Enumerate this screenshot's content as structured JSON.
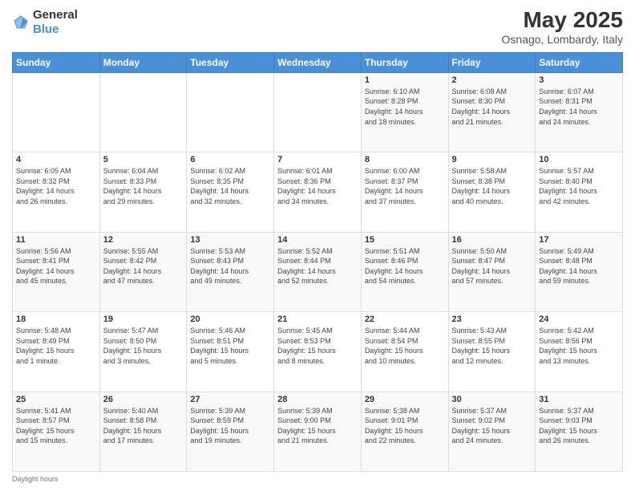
{
  "header": {
    "logo_general": "General",
    "logo_blue": "Blue",
    "month": "May 2025",
    "location": "Osnago, Lombardy, Italy"
  },
  "weekdays": [
    "Sunday",
    "Monday",
    "Tuesday",
    "Wednesday",
    "Thursday",
    "Friday",
    "Saturday"
  ],
  "weeks": [
    [
      {
        "day": "",
        "info": ""
      },
      {
        "day": "",
        "info": ""
      },
      {
        "day": "",
        "info": ""
      },
      {
        "day": "",
        "info": ""
      },
      {
        "day": "1",
        "info": "Sunrise: 6:10 AM\nSunset: 8:28 PM\nDaylight: 14 hours\nand 18 minutes."
      },
      {
        "day": "2",
        "info": "Sunrise: 6:08 AM\nSunset: 8:30 PM\nDaylight: 14 hours\nand 21 minutes."
      },
      {
        "day": "3",
        "info": "Sunrise: 6:07 AM\nSunset: 8:31 PM\nDaylight: 14 hours\nand 24 minutes."
      }
    ],
    [
      {
        "day": "4",
        "info": "Sunrise: 6:05 AM\nSunset: 8:32 PM\nDaylight: 14 hours\nand 26 minutes."
      },
      {
        "day": "5",
        "info": "Sunrise: 6:04 AM\nSunset: 8:33 PM\nDaylight: 14 hours\nand 29 minutes."
      },
      {
        "day": "6",
        "info": "Sunrise: 6:02 AM\nSunset: 8:35 PM\nDaylight: 14 hours\nand 32 minutes."
      },
      {
        "day": "7",
        "info": "Sunrise: 6:01 AM\nSunset: 8:36 PM\nDaylight: 14 hours\nand 34 minutes."
      },
      {
        "day": "8",
        "info": "Sunrise: 6:00 AM\nSunset: 8:37 PM\nDaylight: 14 hours\nand 37 minutes."
      },
      {
        "day": "9",
        "info": "Sunrise: 5:58 AM\nSunset: 8:38 PM\nDaylight: 14 hours\nand 40 minutes."
      },
      {
        "day": "10",
        "info": "Sunrise: 5:57 AM\nSunset: 8:40 PM\nDaylight: 14 hours\nand 42 minutes."
      }
    ],
    [
      {
        "day": "11",
        "info": "Sunrise: 5:56 AM\nSunset: 8:41 PM\nDaylight: 14 hours\nand 45 minutes."
      },
      {
        "day": "12",
        "info": "Sunrise: 5:55 AM\nSunset: 8:42 PM\nDaylight: 14 hours\nand 47 minutes."
      },
      {
        "day": "13",
        "info": "Sunrise: 5:53 AM\nSunset: 8:43 PM\nDaylight: 14 hours\nand 49 minutes."
      },
      {
        "day": "14",
        "info": "Sunrise: 5:52 AM\nSunset: 8:44 PM\nDaylight: 14 hours\nand 52 minutes."
      },
      {
        "day": "15",
        "info": "Sunrise: 5:51 AM\nSunset: 8:46 PM\nDaylight: 14 hours\nand 54 minutes."
      },
      {
        "day": "16",
        "info": "Sunrise: 5:50 AM\nSunset: 8:47 PM\nDaylight: 14 hours\nand 57 minutes."
      },
      {
        "day": "17",
        "info": "Sunrise: 5:49 AM\nSunset: 8:48 PM\nDaylight: 14 hours\nand 59 minutes."
      }
    ],
    [
      {
        "day": "18",
        "info": "Sunrise: 5:48 AM\nSunset: 8:49 PM\nDaylight: 15 hours\nand 1 minute."
      },
      {
        "day": "19",
        "info": "Sunrise: 5:47 AM\nSunset: 8:50 PM\nDaylight: 15 hours\nand 3 minutes."
      },
      {
        "day": "20",
        "info": "Sunrise: 5:46 AM\nSunset: 8:51 PM\nDaylight: 15 hours\nand 5 minutes."
      },
      {
        "day": "21",
        "info": "Sunrise: 5:45 AM\nSunset: 8:53 PM\nDaylight: 15 hours\nand 8 minutes."
      },
      {
        "day": "22",
        "info": "Sunrise: 5:44 AM\nSunset: 8:54 PM\nDaylight: 15 hours\nand 10 minutes."
      },
      {
        "day": "23",
        "info": "Sunrise: 5:43 AM\nSunset: 8:55 PM\nDaylight: 15 hours\nand 12 minutes."
      },
      {
        "day": "24",
        "info": "Sunrise: 5:42 AM\nSunset: 8:56 PM\nDaylight: 15 hours\nand 13 minutes."
      }
    ],
    [
      {
        "day": "25",
        "info": "Sunrise: 5:41 AM\nSunset: 8:57 PM\nDaylight: 15 hours\nand 15 minutes."
      },
      {
        "day": "26",
        "info": "Sunrise: 5:40 AM\nSunset: 8:58 PM\nDaylight: 15 hours\nand 17 minutes."
      },
      {
        "day": "27",
        "info": "Sunrise: 5:39 AM\nSunset: 8:59 PM\nDaylight: 15 hours\nand 19 minutes."
      },
      {
        "day": "28",
        "info": "Sunrise: 5:39 AM\nSunset: 9:00 PM\nDaylight: 15 hours\nand 21 minutes."
      },
      {
        "day": "29",
        "info": "Sunrise: 5:38 AM\nSunset: 9:01 PM\nDaylight: 15 hours\nand 22 minutes."
      },
      {
        "day": "30",
        "info": "Sunrise: 5:37 AM\nSunset: 9:02 PM\nDaylight: 15 hours\nand 24 minutes."
      },
      {
        "day": "31",
        "info": "Sunrise: 5:37 AM\nSunset: 9:03 PM\nDaylight: 15 hours\nand 26 minutes."
      }
    ]
  ],
  "footer": {
    "note": "Daylight hours"
  }
}
